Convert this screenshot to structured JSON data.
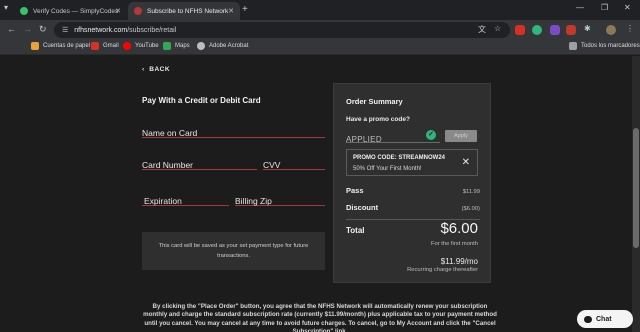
{
  "browser": {
    "tabs": [
      {
        "title": "Verify Codes — SimplyCodes",
        "active": false,
        "favicon_color": "#36c26b"
      },
      {
        "title": "Subscribe to NFHS Network",
        "active": true,
        "favicon_color": "#b03a3a"
      }
    ],
    "url_host": "nfhsnetwork.com",
    "url_path": "/subscribe/retail",
    "bookmarks": [
      {
        "label": "Cuentas de papel",
        "color": "#e8a33a"
      },
      {
        "label": "Gmail",
        "color": "#d93025"
      },
      {
        "label": "YouTube",
        "color": "#ff0000"
      },
      {
        "label": "Maps",
        "color": "#34a853"
      },
      {
        "label": "Adobe Acrobat",
        "color": "#bdbdbd"
      }
    ],
    "all_bookmarks_label": "Todos los marcadores"
  },
  "page": {
    "back_label": "BACK",
    "payment_title": "Pay With a Credit or Debit Card",
    "fields": {
      "name_on_card": "Name on Card",
      "card_number": "Card Number",
      "cvv": "CVV",
      "expiration": "Expiration",
      "billing_zip": "Billing Zip"
    },
    "card_notice": "This card will be saved as your set payment type for future transactions.",
    "terms": "By clicking the \"Place Order\" button, you agree that the NFHS Network will automatically renew your subscription monthly and charge the standard subscription rate (currently $11.99/month) plus applicable tax to your payment method until you cancel. You may cancel at any time to avoid future charges. To cancel, go to My Account and click the \"Cancel Subscription\" link."
  },
  "summary": {
    "title": "Order Summary",
    "promo_question": "Have a promo code?",
    "promo_status": "APPLIED",
    "apply_label": "Apply",
    "promo_code_line": "PROMO CODE: STREAMNOW24",
    "promo_desc": "50% Off Your First Month!",
    "pass_label": "Pass",
    "pass_value": "$11.99",
    "discount_label": "Discount",
    "discount_value": "($6.00)",
    "total_label": "Total",
    "total_value": "$6.00",
    "total_sub": "For the first month",
    "monthly_value": "$11.99/mo",
    "monthly_sub": "Recurring charge thereafter"
  },
  "chat": {
    "label": "Chat"
  },
  "colors": {
    "accent_underline": "#b0333c",
    "success": "#2fb67c"
  }
}
